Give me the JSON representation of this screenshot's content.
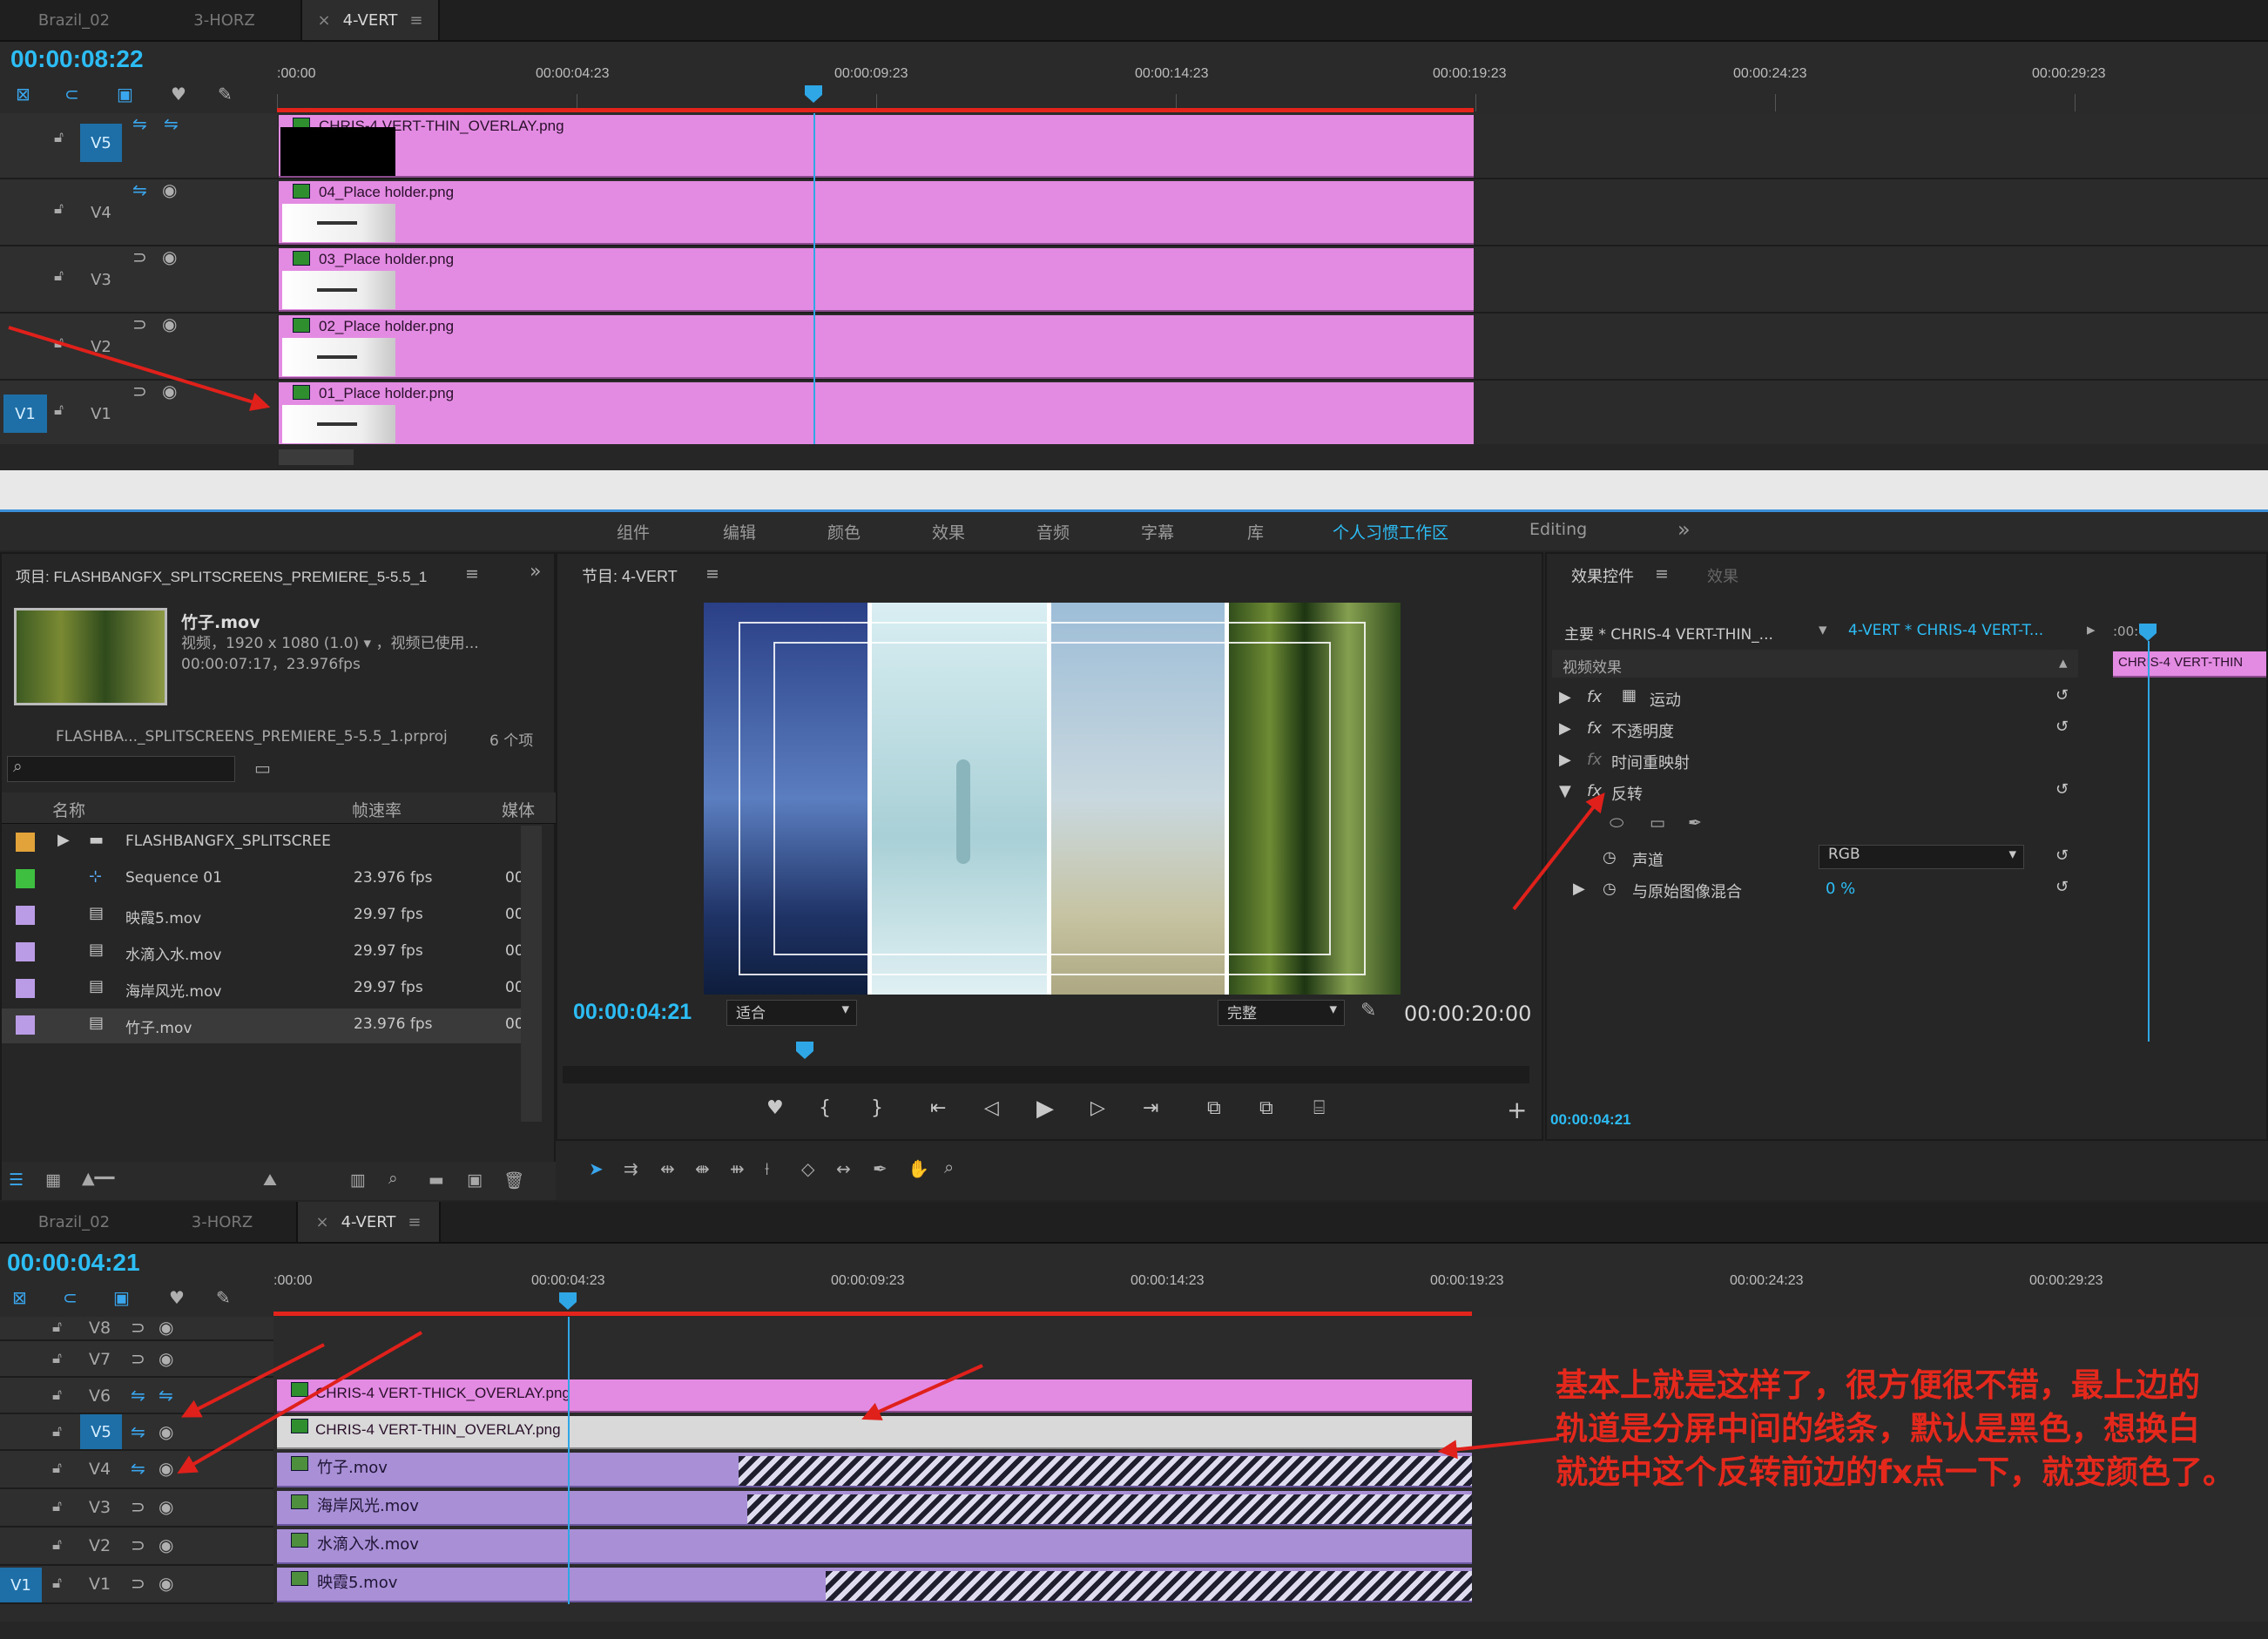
{
  "colors": {
    "accent": "#2dbdf5",
    "clip_pink": "#e38be3",
    "clip_purple": "#a98fd6",
    "annotation_red": "#e5281c"
  },
  "seq_tabs": [
    {
      "label": "Brazil_02"
    },
    {
      "label": "3-HORZ"
    },
    {
      "label": "4-VERT",
      "close": "×",
      "menu": "≡"
    }
  ],
  "top_timeline": {
    "timecode": "00:00:08:22",
    "ruler_labels": [
      ":00:00",
      "00:00:04:23",
      "00:00:09:23",
      "00:00:14:23",
      "00:00:19:23",
      "00:00:24:23",
      "00:00:29:23"
    ],
    "tracks": [
      {
        "name": "V5",
        "clip": "CHRIS-4 VERT-THIN_OVERLAY.png"
      },
      {
        "name": "V4",
        "clip": "04_Place holder.png"
      },
      {
        "name": "V3",
        "clip": "03_Place holder.png"
      },
      {
        "name": "V2",
        "clip": "02_Place holder.png"
      },
      {
        "name": "V1",
        "clip": "01_Place holder.png",
        "source": "V1"
      }
    ]
  },
  "workspace": {
    "items": [
      "组件",
      "编辑",
      "颜色",
      "效果",
      "音频",
      "字幕",
      "库",
      "个人习惯工作区",
      "Editing"
    ],
    "active": "个人习惯工作区",
    "more": "»"
  },
  "project": {
    "title": "项目: FLASHBANGFX_SPLITSCREENS_PREMIERE_5-5.5_1",
    "menu": "≡",
    "expand": "»",
    "preview_name": "竹子.mov",
    "preview_info1": "视频，1920 x 1080 (1.0) ▾ ，视频已使用...",
    "preview_info2": "00:00:07:17，23.976fps",
    "file": "FLASHBA..._SPLITSCREENS_PREMIERE_5-5.5_1.prproj",
    "count": "6 个项",
    "search_icon": "⌕",
    "columns": {
      "name": "名称",
      "rate": "帧速率",
      "media": "媒体"
    },
    "items": [
      {
        "name": "FLASHBANGFX_SPLITSCREE",
        "rate": "",
        "swatch": "#e2a33a",
        "type": "folder"
      },
      {
        "name": "Sequence 01",
        "rate": "23.976 fps",
        "swatch": "#3fbf3f",
        "type": "sequence"
      },
      {
        "name": "映霞5.mov",
        "rate": "29.97 fps",
        "swatch": "#b99be6",
        "type": "clip"
      },
      {
        "name": "水滴入水.mov",
        "rate": "29.97 fps",
        "swatch": "#b99be6",
        "type": "clip"
      },
      {
        "name": "海岸风光.mov",
        "rate": "29.97 fps",
        "swatch": "#b99be6",
        "type": "clip"
      },
      {
        "name": "竹子.mov",
        "rate": "23.976 fps",
        "swatch": "#b99be6",
        "type": "clip"
      }
    ],
    "trunc": "00"
  },
  "program": {
    "title": "节目: 4-VERT",
    "menu": "≡",
    "timecode": "00:00:04:21",
    "fit": "适合",
    "quality": "完整",
    "duration": "00:00:20:00"
  },
  "effect_controls": {
    "tabs": [
      "效果控件",
      "效果"
    ],
    "menu": "≡",
    "master": "主要 * CHRIS-4 VERT-THIN_...",
    "seq": "4-VERT * CHRIS-4 VERT-T...",
    "mini_clip": "CHRIS-4 VERT-THIN",
    "mini_ruler": ":00:00",
    "section": "视频效果",
    "effects": [
      "运动",
      "不透明度",
      "时间重映射",
      "反转"
    ],
    "channel_label": "声道",
    "channel_value": "RGB",
    "blend_label": "与原始图像混合",
    "blend_value": "0 %",
    "timecode": "00:00:04:21"
  },
  "bottom_timeline": {
    "timecode": "00:00:04:21",
    "ruler_labels": [
      ":00:00",
      "00:00:04:23",
      "00:00:09:23",
      "00:00:14:23",
      "00:00:19:23",
      "00:00:24:23",
      "00:00:29:23"
    ],
    "tracks": [
      {
        "name": "V8"
      },
      {
        "name": "V7"
      },
      {
        "name": "V6",
        "clip": "CHRIS-4 VERT-THICK_OVERLAY.png"
      },
      {
        "name": "V5",
        "clip": "CHRIS-4 VERT-THIN_OVERLAY.png"
      },
      {
        "name": "V4",
        "clip": "竹子.mov"
      },
      {
        "name": "V3",
        "clip": "海岸风光.mov"
      },
      {
        "name": "V2",
        "clip": "水滴入水.mov"
      },
      {
        "name": "V1",
        "clip": "映霞5.mov",
        "source": "V1"
      }
    ]
  },
  "annotation": {
    "line1": "基本上就是这样了，很方便很不错，最上边的",
    "line2": "轨道是分屏中间的线条，默认是黑色，想换白",
    "line3": "就选中这个反转前边的fx点一下，就变颜色了。"
  }
}
